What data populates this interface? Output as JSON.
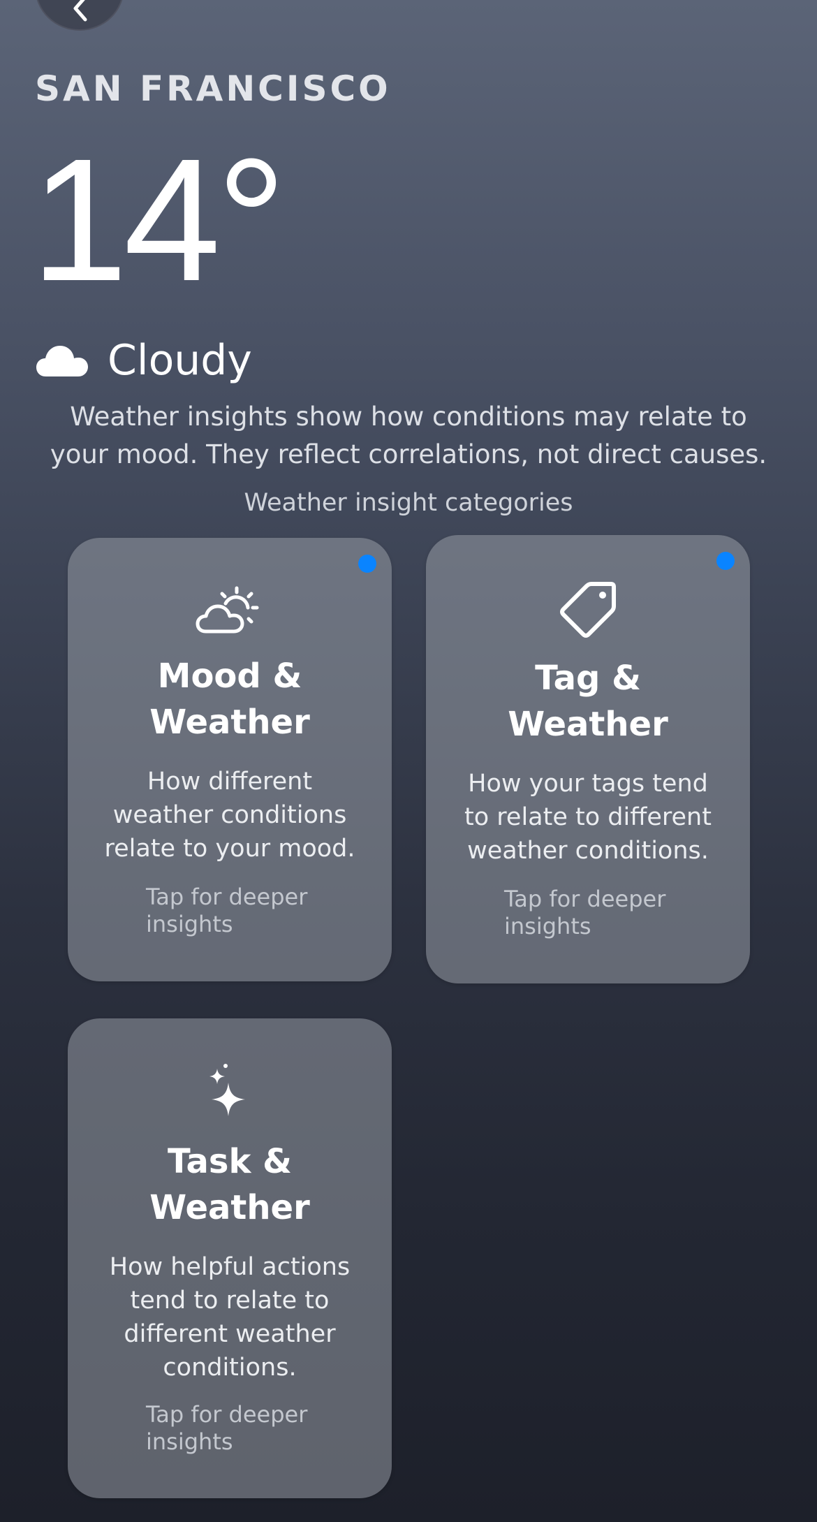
{
  "location": {
    "city": "SAN FRANCISCO"
  },
  "current": {
    "temperature": "14°",
    "condition": "Cloudy",
    "condition_icon": "cloud-icon"
  },
  "explanation": "Weather insights show how conditions may relate to your mood. They reflect correlations, not direct causes.",
  "section_label": "Weather insight categories",
  "accent_colors": {
    "unread_dot": "#0a84ff"
  },
  "cards": [
    {
      "icon": "cloud-sun-icon",
      "title": "Mood & Weather",
      "description": "How different weather conditions relate to your mood.",
      "hint": "Tap for deeper insights",
      "unread": true
    },
    {
      "icon": "tag-icon",
      "title": "Tag & Weather",
      "description": "How your tags tend to relate to different weather conditions.",
      "hint": "Tap for deeper insights",
      "unread": true
    },
    {
      "icon": "sparkles-icon",
      "title": "Task & Weather",
      "description": "How helpful actions tend to relate to different weather conditions.",
      "hint": "Tap for deeper insights",
      "unread": false
    }
  ]
}
